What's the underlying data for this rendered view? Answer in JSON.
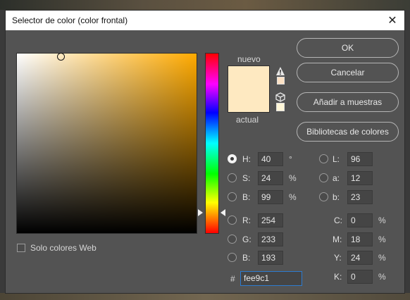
{
  "dialog": {
    "title": "Selector de color (color frontal)",
    "close_glyph": "✕"
  },
  "swatches": {
    "new_label": "nuevo",
    "current_label": "actual",
    "new_color": "#fee9c1",
    "current_color": "#fee9c1"
  },
  "buttons": {
    "ok": "OK",
    "cancel": "Cancelar",
    "add_to_swatches": "Añadir a muestras",
    "color_libraries": "Bibliotecas de colores"
  },
  "hsb": {
    "h": {
      "label": "H:",
      "value": "40",
      "unit": "°",
      "selected": true
    },
    "s": {
      "label": "S:",
      "value": "24",
      "unit": "%"
    },
    "b": {
      "label": "B:",
      "value": "99",
      "unit": "%"
    }
  },
  "rgb": {
    "r": {
      "label": "R:",
      "value": "254"
    },
    "g": {
      "label": "G:",
      "value": "233"
    },
    "b": {
      "label": "B:",
      "value": "193"
    }
  },
  "lab": {
    "l": {
      "label": "L:",
      "value": "96"
    },
    "a": {
      "label": "a:",
      "value": "12"
    },
    "b": {
      "label": "b:",
      "value": "23"
    }
  },
  "cmyk": {
    "c": {
      "label": "C:",
      "value": "0",
      "unit": "%"
    },
    "m": {
      "label": "M:",
      "value": "18",
      "unit": "%"
    },
    "y": {
      "label": "Y:",
      "value": "24",
      "unit": "%"
    },
    "k": {
      "label": "K:",
      "value": "0",
      "unit": "%"
    }
  },
  "hex": {
    "hash": "#",
    "value": "fee9c1"
  },
  "web_colors": {
    "label": "Solo colores Web",
    "checked": false
  },
  "icons": {
    "gamut_warning": "warning-triangle-icon",
    "web_safe": "cube-icon"
  },
  "colors": {
    "dialog_bg": "#535353",
    "field_hue": "#ffaa00",
    "gamut_swatch": "#fbe1c4",
    "websafe_swatch": "#fff7d8"
  }
}
